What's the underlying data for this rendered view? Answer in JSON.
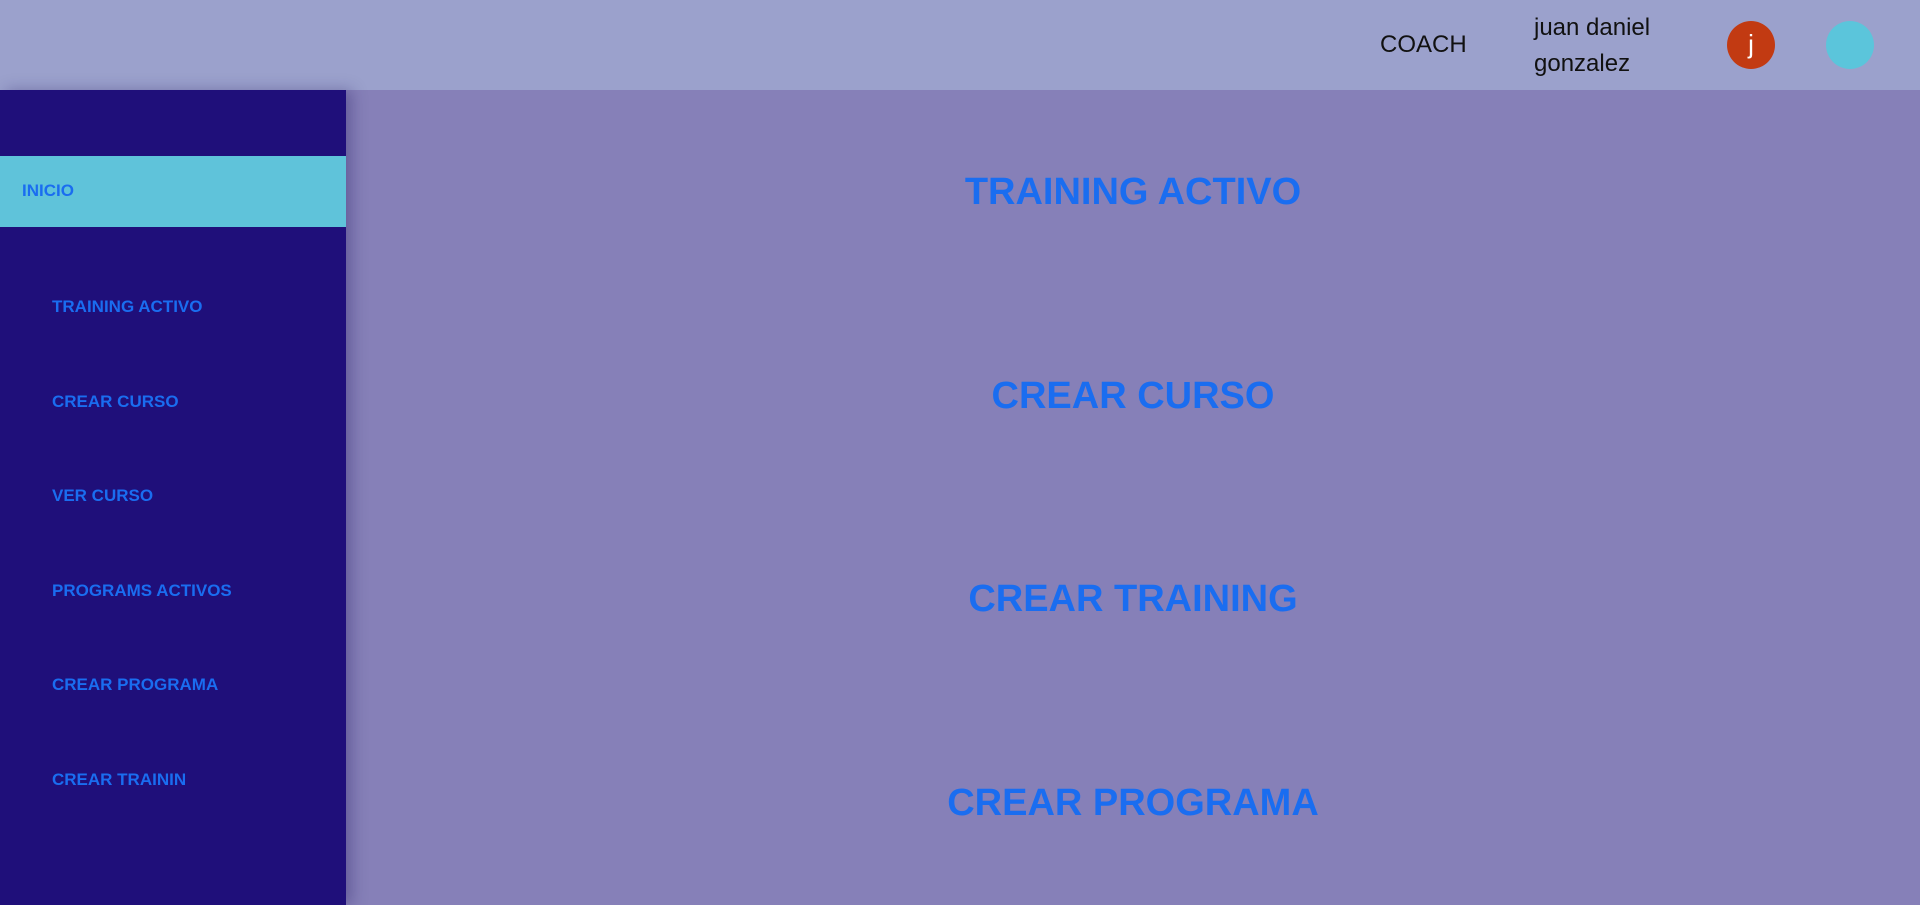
{
  "header": {
    "role": "COACH",
    "user_name": "juan daniel gonzalez",
    "avatar_initial": "j"
  },
  "sidebar": {
    "home_label": "INICIO",
    "items": [
      {
        "label": "TRAINING ACTIVO"
      },
      {
        "label": "CREAR CURSO"
      },
      {
        "label": "VER CURSO"
      },
      {
        "label": "PROGRAMS ACTIVOS"
      },
      {
        "label": "CREAR PROGRAMA"
      },
      {
        "label": "CREAR TRAININ"
      }
    ]
  },
  "main": {
    "links": [
      {
        "label": "TRAINING ACTIVO"
      },
      {
        "label": "CREAR CURSO"
      },
      {
        "label": "CREAR TRAINING"
      },
      {
        "label": "CREAR PROGRAMA"
      }
    ]
  },
  "colors": {
    "header_bg": "#9ba1cc",
    "sidebar_bg": "#1f0f7a",
    "active_item_bg": "#5fc3da",
    "content_bg": "#8680b8",
    "link_text": "#1a6df0",
    "avatar_bg": "#c23a12"
  }
}
